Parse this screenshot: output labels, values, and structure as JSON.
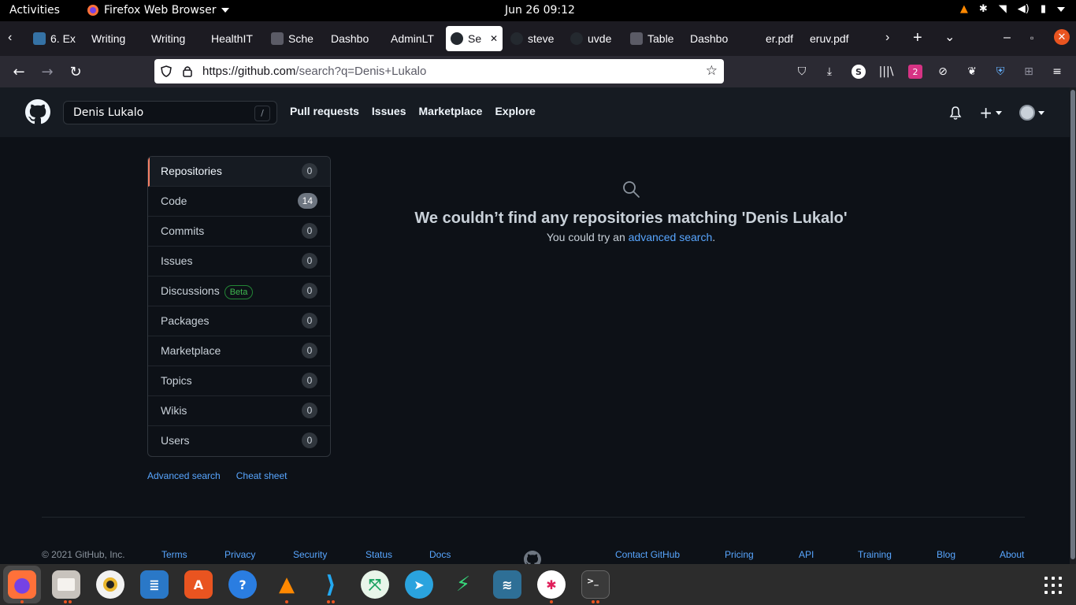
{
  "system_bar": {
    "activities": "Activities",
    "app_name": "Firefox Web Browser",
    "clock": "Jun 26  09:12"
  },
  "browser": {
    "tabs": [
      {
        "title": "6. Ex",
        "icon": "python-icon",
        "active": false
      },
      {
        "title": "Writing",
        "icon": "",
        "active": false
      },
      {
        "title": "Writing",
        "icon": "",
        "active": false
      },
      {
        "title": "HealthIT",
        "icon": "",
        "active": false
      },
      {
        "title": "Sche",
        "icon": "puzzle-icon",
        "active": false
      },
      {
        "title": "Dashbo",
        "icon": "",
        "active": false
      },
      {
        "title": "AdminLT",
        "icon": "",
        "active": false
      },
      {
        "title": "Se",
        "icon": "github-icon",
        "active": true
      },
      {
        "title": "steve",
        "icon": "github-icon",
        "active": false
      },
      {
        "title": "uvde",
        "icon": "github-icon",
        "active": false
      },
      {
        "title": "Table",
        "icon": "puzzle-icon",
        "active": false
      },
      {
        "title": "Dashbo",
        "icon": "",
        "active": false
      },
      {
        "title": "er.pdf",
        "icon": "",
        "active": false
      },
      {
        "title": "eruv.pdf",
        "icon": "",
        "active": false
      }
    ],
    "url_host": "https://github.com",
    "url_rest": "/search?q=Denis+Lukalo"
  },
  "github": {
    "search_value": "Denis Lukalo",
    "search_shortcut": "/",
    "nav": [
      "Pull requests",
      "Issues",
      "Marketplace",
      "Explore"
    ],
    "menu": [
      {
        "label": "Repositories",
        "count": "0",
        "selected": true
      },
      {
        "label": "Code",
        "count": "14",
        "selected": false
      },
      {
        "label": "Commits",
        "count": "0",
        "selected": false
      },
      {
        "label": "Issues",
        "count": "0",
        "selected": false
      },
      {
        "label": "Discussions",
        "count": "0",
        "selected": false,
        "badge": "Beta"
      },
      {
        "label": "Packages",
        "count": "0",
        "selected": false
      },
      {
        "label": "Marketplace",
        "count": "0",
        "selected": false
      },
      {
        "label": "Topics",
        "count": "0",
        "selected": false
      },
      {
        "label": "Wikis",
        "count": "0",
        "selected": false
      },
      {
        "label": "Users",
        "count": "0",
        "selected": false
      }
    ],
    "side_links": {
      "advanced": "Advanced search",
      "cheat": "Cheat sheet"
    },
    "blank": {
      "heading": "We couldn’t find any repositories matching 'Denis Lukalo'",
      "text_before": "You could try an ",
      "link": "advanced search",
      "text_after": "."
    },
    "footer": {
      "copyright": "© 2021 GitHub, Inc.",
      "links": [
        "Terms",
        "Privacy",
        "Security",
        "Status",
        "Docs",
        "Contact GitHub",
        "Pricing",
        "API",
        "Training",
        "Blog",
        "About"
      ]
    }
  },
  "colors": {
    "page_bg": "#0d1117",
    "header_bg": "#161b22",
    "link": "#58a6ff",
    "selected_accent": "#f78166"
  }
}
